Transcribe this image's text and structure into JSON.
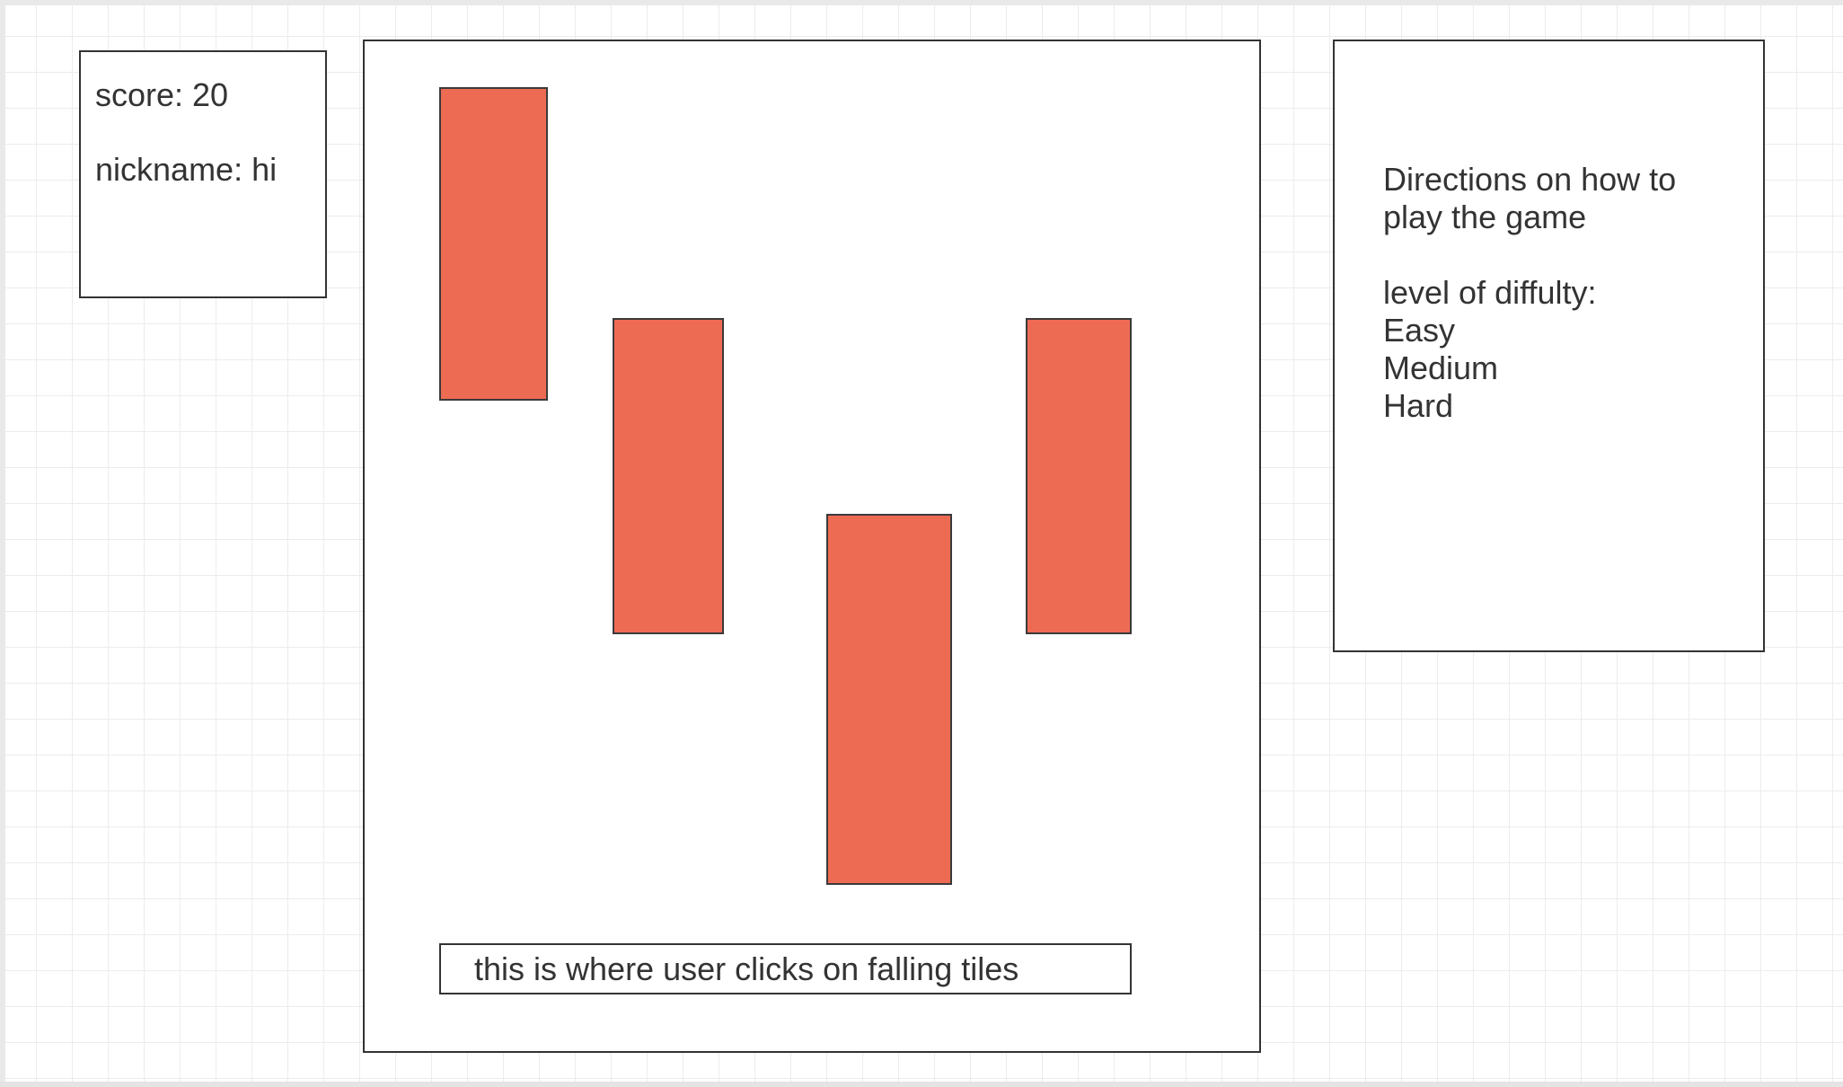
{
  "score_panel": {
    "score_text": "score: 20",
    "nickname_text": "nickname: hi"
  },
  "game_area": {
    "tile_count": 4,
    "tile_color": "#ee6b53",
    "click_zone_text": "this is where user clicks on falling tiles"
  },
  "directions_panel": {
    "directions_line_1": "Directions on how to",
    "directions_line_2": "play the game",
    "difficulty_heading": "level of diffulty:",
    "difficulty_options": [
      "Easy",
      "Medium",
      "Hard"
    ]
  }
}
